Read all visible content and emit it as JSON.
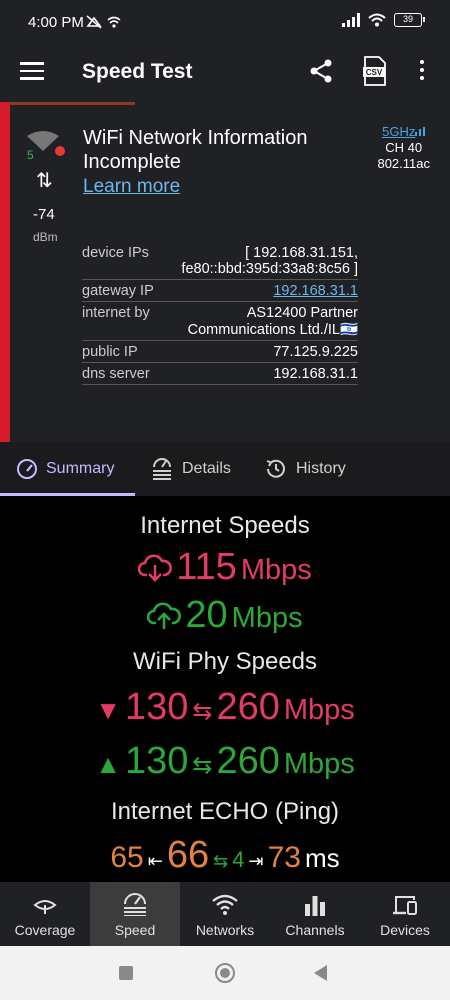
{
  "status": {
    "time": "4:00 PM",
    "battery": "39"
  },
  "appbar": {
    "title": "Speed Test"
  },
  "wifi": {
    "signal_number": "5",
    "rssi": "-74",
    "rssi_unit": "dBm",
    "warning": "WiFi Network Information Incomplete",
    "learn_more": "Learn more",
    "band": "5GHz",
    "channel": "CH 40",
    "standard": "802.11ac"
  },
  "ip_info": [
    {
      "label": "device IPs",
      "value": "[ 192.168.31.151,\nfe80::bbd:395d:33a8:8c56 ]"
    },
    {
      "label": "gateway IP",
      "value": "192.168.31.1",
      "link": true
    },
    {
      "label": "internet by",
      "value": "AS12400 Partner\nCommunications Ltd./IL🇮🇱"
    },
    {
      "label": "public IP",
      "value": "77.125.9.225"
    },
    {
      "label": "dns server",
      "value": "192.168.31.1"
    }
  ],
  "tabs": [
    {
      "label": "Summary",
      "active": true
    },
    {
      "label": "Details"
    },
    {
      "label": "History"
    }
  ],
  "speeds": {
    "internet_title": "Internet Speeds",
    "download_value": "115",
    "download_unit": "Mbps",
    "upload_value": "20",
    "upload_unit": "Mbps",
    "phy_title": "WiFi Phy Speeds",
    "phy_down_current": "130",
    "phy_down_max": "260",
    "phy_up_current": "130",
    "phy_up_max": "260",
    "phy_unit": "Mbps",
    "ping_title": "Internet ECHO (Ping)",
    "ping_min": "65",
    "ping_avg": "66",
    "ping_jitter": "4",
    "ping_max": "73",
    "ping_unit": "ms"
  },
  "bottom_nav": [
    {
      "label": "Coverage",
      "icon": "coverage-icon"
    },
    {
      "label": "Speed",
      "icon": "speedometer-icon",
      "active": true
    },
    {
      "label": "Networks",
      "icon": "wifi-icon"
    },
    {
      "label": "Channels",
      "icon": "bar-chart-icon"
    },
    {
      "label": "Devices",
      "icon": "devices-icon"
    }
  ],
  "colors": {
    "accent": "#c9b8ff",
    "download": "#e33b64",
    "upload": "#2aa83a",
    "ping": "#e4833f",
    "alert": "#d81b2a"
  }
}
